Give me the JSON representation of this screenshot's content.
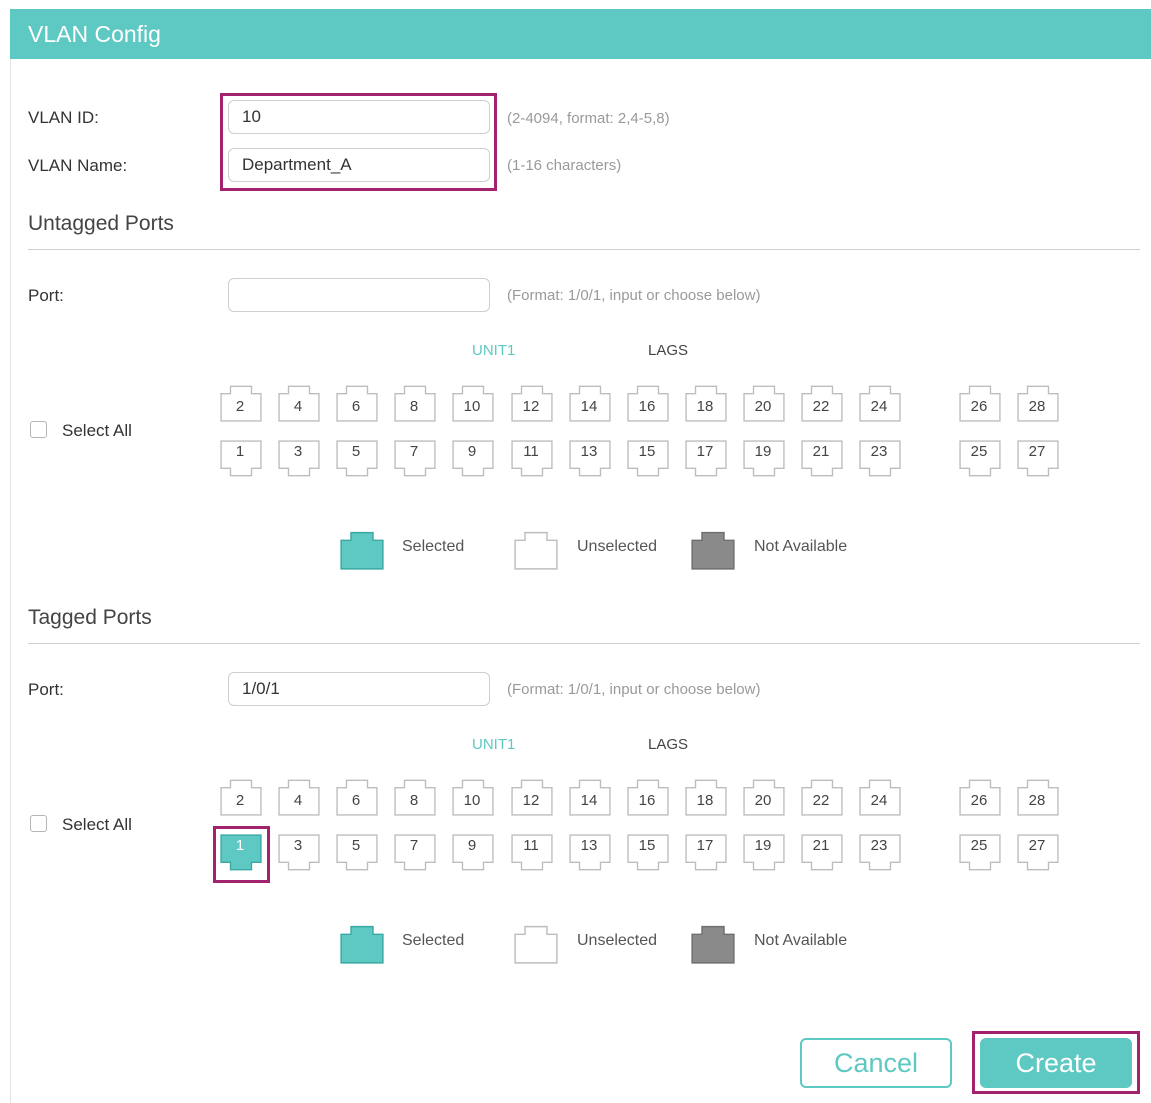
{
  "title": "VLAN Config",
  "vlan": {
    "id_label": "VLAN ID:",
    "id_value": "10",
    "id_hint": "(2-4094, format: 2,4-5,8)",
    "name_label": "VLAN Name:",
    "name_value": "Department_A",
    "name_hint": "(1-16 characters)"
  },
  "untagged": {
    "heading": "Untagged Ports",
    "port_label": "Port:",
    "port_value": "",
    "port_hint": "(Format: 1/0/1, input or choose below)",
    "unit_label": "UNIT1",
    "lags_label": "LAGS",
    "select_all": "Select All",
    "selected_ports": []
  },
  "tagged": {
    "heading": "Tagged Ports",
    "port_label": "Port:",
    "port_value": "1/0/1",
    "port_hint": "(Format: 1/0/1, input or choose below)",
    "unit_label": "UNIT1",
    "lags_label": "LAGS",
    "select_all": "Select All",
    "selected_ports": [
      "1"
    ]
  },
  "ports": {
    "top_row": [
      "2",
      "4",
      "6",
      "8",
      "10",
      "12",
      "14",
      "16",
      "18",
      "20",
      "22",
      "24",
      "26",
      "28"
    ],
    "bottom_row": [
      "1",
      "3",
      "5",
      "7",
      "9",
      "11",
      "13",
      "15",
      "17",
      "19",
      "21",
      "23",
      "25",
      "27"
    ]
  },
  "legend": {
    "selected": "Selected",
    "unselected": "Unselected",
    "not_available": "Not Available"
  },
  "buttons": {
    "cancel": "Cancel",
    "create": "Create"
  },
  "colors": {
    "accent": "#5ec8c3",
    "highlight": "#a3226e",
    "not_available": "#8a8a8a"
  }
}
